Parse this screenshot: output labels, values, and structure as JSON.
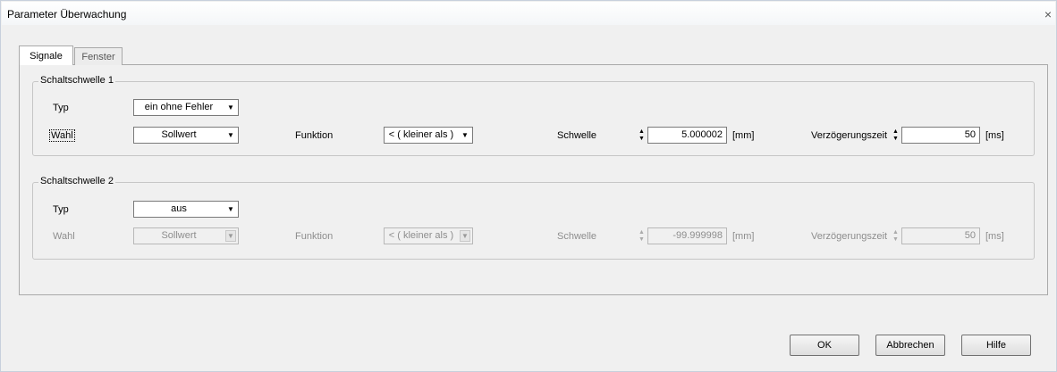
{
  "window": {
    "title": "Parameter Überwachung",
    "close_glyph": "×"
  },
  "tabs": [
    {
      "label": "Signale",
      "active": true
    },
    {
      "label": "Fenster",
      "active": false
    }
  ],
  "groups": [
    {
      "legend": "Schaltschwelle 1",
      "enabled": true,
      "typ_label": "Typ",
      "typ_value": "ein ohne Fehler",
      "wahl_label": "Wahl",
      "wahl_value": "Sollwert",
      "funktion_label": "Funktion",
      "funktion_value": "< ( kleiner als )",
      "schwelle_label": "Schwelle",
      "schwelle_value": "5.000002",
      "schwelle_unit": "[mm]",
      "verz_label": "Verzögerungszeit",
      "verz_value": "50",
      "verz_unit": "[ms]"
    },
    {
      "legend": "Schaltschwelle 2",
      "enabled": false,
      "typ_label": "Typ",
      "typ_value": "aus",
      "wahl_label": "Wahl",
      "wahl_value": "Sollwert",
      "funktion_label": "Funktion",
      "funktion_value": "< ( kleiner als )",
      "schwelle_label": "Schwelle",
      "schwelle_value": "-99.999998",
      "schwelle_unit": "[mm]",
      "verz_label": "Verzögerungszeit",
      "verz_value": "50",
      "verz_unit": "[ms]"
    }
  ],
  "buttons": {
    "ok": "OK",
    "abbrechen": "Abbrechen",
    "hilfe": "Hilfe"
  },
  "icons": {
    "dropdown": "triangle-down",
    "spinner": "up-down-arrows"
  }
}
